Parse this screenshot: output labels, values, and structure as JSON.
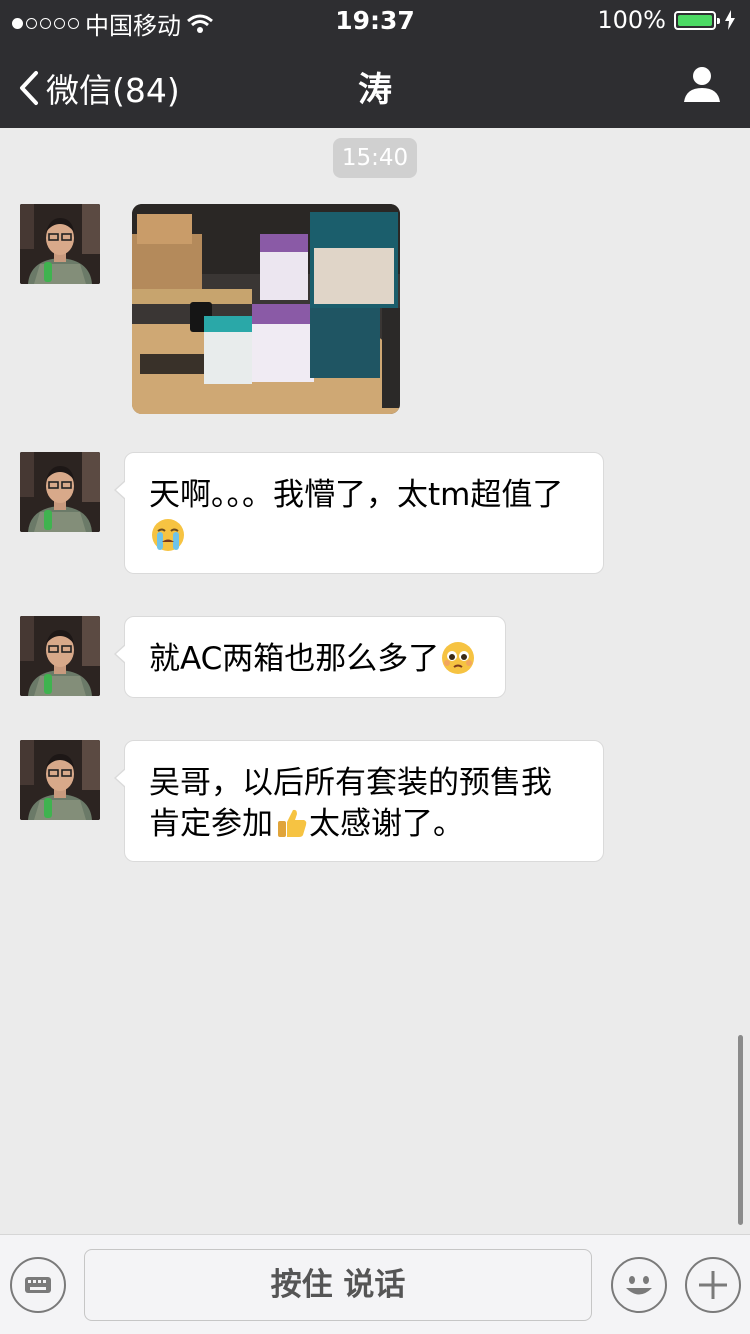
{
  "status_bar": {
    "carrier": "中国移动",
    "time": "19:37",
    "battery": "100%"
  },
  "nav": {
    "back_label": "微信(84)",
    "title": "涛"
  },
  "chat": {
    "timestamp": "15:40",
    "messages": [
      {
        "type": "image"
      },
      {
        "type": "text",
        "text": "天啊。。。我懵了，太tm超值了",
        "emoji": "crying-face"
      },
      {
        "type": "text",
        "text": "就AC两箱也那么多了",
        "emoji": "pleading-face"
      },
      {
        "type": "text",
        "text": "吴哥，以后所有套装的预售我肯定参加",
        "emoji": "thumbs-up",
        "text_after": "太感谢了。"
      }
    ]
  },
  "input_bar": {
    "hold_to_talk": "按住 说话"
  },
  "colors": {
    "nav_bg": "#2e2e31",
    "chat_bg": "#ebebeb",
    "battery_green": "#4cd964"
  }
}
